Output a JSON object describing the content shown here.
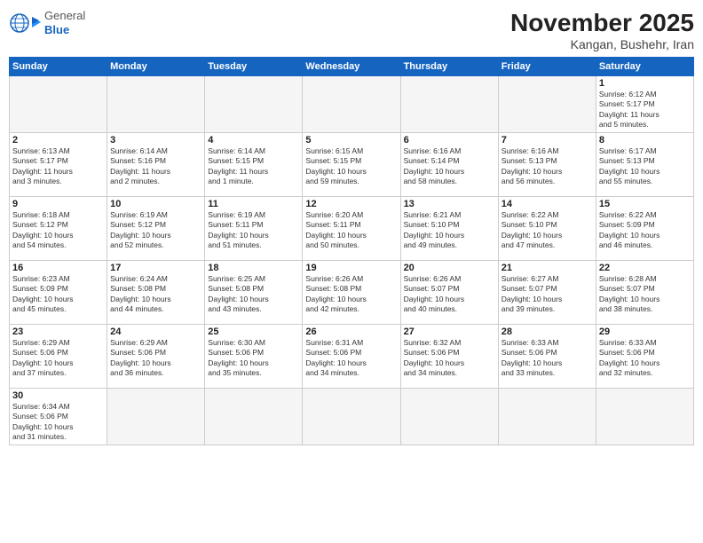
{
  "header": {
    "logo_general": "General",
    "logo_blue": "Blue",
    "month_title": "November 2025",
    "location": "Kangan, Bushehr, Iran"
  },
  "weekdays": [
    "Sunday",
    "Monday",
    "Tuesday",
    "Wednesday",
    "Thursday",
    "Friday",
    "Saturday"
  ],
  "weeks": [
    [
      {
        "day": "",
        "info": ""
      },
      {
        "day": "",
        "info": ""
      },
      {
        "day": "",
        "info": ""
      },
      {
        "day": "",
        "info": ""
      },
      {
        "day": "",
        "info": ""
      },
      {
        "day": "",
        "info": ""
      },
      {
        "day": "1",
        "info": "Sunrise: 6:12 AM\nSunset: 5:17 PM\nDaylight: 11 hours\nand 5 minutes."
      }
    ],
    [
      {
        "day": "2",
        "info": "Sunrise: 6:13 AM\nSunset: 5:17 PM\nDaylight: 11 hours\nand 3 minutes."
      },
      {
        "day": "3",
        "info": "Sunrise: 6:14 AM\nSunset: 5:16 PM\nDaylight: 11 hours\nand 2 minutes."
      },
      {
        "day": "4",
        "info": "Sunrise: 6:14 AM\nSunset: 5:15 PM\nDaylight: 11 hours\nand 1 minute."
      },
      {
        "day": "5",
        "info": "Sunrise: 6:15 AM\nSunset: 5:15 PM\nDaylight: 10 hours\nand 59 minutes."
      },
      {
        "day": "6",
        "info": "Sunrise: 6:16 AM\nSunset: 5:14 PM\nDaylight: 10 hours\nand 58 minutes."
      },
      {
        "day": "7",
        "info": "Sunrise: 6:16 AM\nSunset: 5:13 PM\nDaylight: 10 hours\nand 56 minutes."
      },
      {
        "day": "8",
        "info": "Sunrise: 6:17 AM\nSunset: 5:13 PM\nDaylight: 10 hours\nand 55 minutes."
      }
    ],
    [
      {
        "day": "9",
        "info": "Sunrise: 6:18 AM\nSunset: 5:12 PM\nDaylight: 10 hours\nand 54 minutes."
      },
      {
        "day": "10",
        "info": "Sunrise: 6:19 AM\nSunset: 5:12 PM\nDaylight: 10 hours\nand 52 minutes."
      },
      {
        "day": "11",
        "info": "Sunrise: 6:19 AM\nSunset: 5:11 PM\nDaylight: 10 hours\nand 51 minutes."
      },
      {
        "day": "12",
        "info": "Sunrise: 6:20 AM\nSunset: 5:11 PM\nDaylight: 10 hours\nand 50 minutes."
      },
      {
        "day": "13",
        "info": "Sunrise: 6:21 AM\nSunset: 5:10 PM\nDaylight: 10 hours\nand 49 minutes."
      },
      {
        "day": "14",
        "info": "Sunrise: 6:22 AM\nSunset: 5:10 PM\nDaylight: 10 hours\nand 47 minutes."
      },
      {
        "day": "15",
        "info": "Sunrise: 6:22 AM\nSunset: 5:09 PM\nDaylight: 10 hours\nand 46 minutes."
      }
    ],
    [
      {
        "day": "16",
        "info": "Sunrise: 6:23 AM\nSunset: 5:09 PM\nDaylight: 10 hours\nand 45 minutes."
      },
      {
        "day": "17",
        "info": "Sunrise: 6:24 AM\nSunset: 5:08 PM\nDaylight: 10 hours\nand 44 minutes."
      },
      {
        "day": "18",
        "info": "Sunrise: 6:25 AM\nSunset: 5:08 PM\nDaylight: 10 hours\nand 43 minutes."
      },
      {
        "day": "19",
        "info": "Sunrise: 6:26 AM\nSunset: 5:08 PM\nDaylight: 10 hours\nand 42 minutes."
      },
      {
        "day": "20",
        "info": "Sunrise: 6:26 AM\nSunset: 5:07 PM\nDaylight: 10 hours\nand 40 minutes."
      },
      {
        "day": "21",
        "info": "Sunrise: 6:27 AM\nSunset: 5:07 PM\nDaylight: 10 hours\nand 39 minutes."
      },
      {
        "day": "22",
        "info": "Sunrise: 6:28 AM\nSunset: 5:07 PM\nDaylight: 10 hours\nand 38 minutes."
      }
    ],
    [
      {
        "day": "23",
        "info": "Sunrise: 6:29 AM\nSunset: 5:06 PM\nDaylight: 10 hours\nand 37 minutes."
      },
      {
        "day": "24",
        "info": "Sunrise: 6:29 AM\nSunset: 5:06 PM\nDaylight: 10 hours\nand 36 minutes."
      },
      {
        "day": "25",
        "info": "Sunrise: 6:30 AM\nSunset: 5:06 PM\nDaylight: 10 hours\nand 35 minutes."
      },
      {
        "day": "26",
        "info": "Sunrise: 6:31 AM\nSunset: 5:06 PM\nDaylight: 10 hours\nand 34 minutes."
      },
      {
        "day": "27",
        "info": "Sunrise: 6:32 AM\nSunset: 5:06 PM\nDaylight: 10 hours\nand 34 minutes."
      },
      {
        "day": "28",
        "info": "Sunrise: 6:33 AM\nSunset: 5:06 PM\nDaylight: 10 hours\nand 33 minutes."
      },
      {
        "day": "29",
        "info": "Sunrise: 6:33 AM\nSunset: 5:06 PM\nDaylight: 10 hours\nand 32 minutes."
      }
    ],
    [
      {
        "day": "30",
        "info": "Sunrise: 6:34 AM\nSunset: 5:06 PM\nDaylight: 10 hours\nand 31 minutes."
      },
      {
        "day": "",
        "info": ""
      },
      {
        "day": "",
        "info": ""
      },
      {
        "day": "",
        "info": ""
      },
      {
        "day": "",
        "info": ""
      },
      {
        "day": "",
        "info": ""
      },
      {
        "day": "",
        "info": ""
      }
    ]
  ]
}
